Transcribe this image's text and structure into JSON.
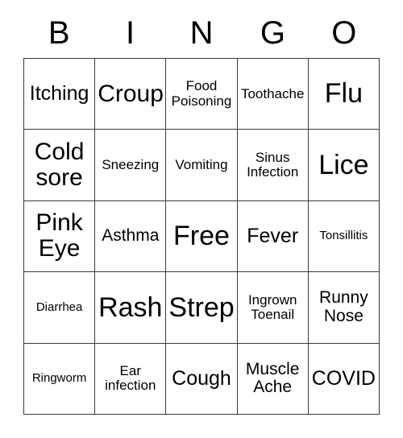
{
  "card": {
    "header_letters": [
      "B",
      "I",
      "N",
      "G",
      "O"
    ],
    "free_space_label": "Free",
    "border_color": "#3a3a3a",
    "background_color": "#ffffff",
    "text_color": "#000000",
    "columns": 5,
    "rows": 5,
    "cells": [
      {
        "text": "Itching",
        "size": "l"
      },
      {
        "text": "Croup",
        "size": "xl"
      },
      {
        "text": "Food\nPoisoning",
        "size": "s"
      },
      {
        "text": "Toothache",
        "size": "s"
      },
      {
        "text": "Flu",
        "size": "xxl"
      },
      {
        "text": "Cold\nsore",
        "size": "xl"
      },
      {
        "text": "Sneezing",
        "size": "s"
      },
      {
        "text": "Vomiting",
        "size": "s"
      },
      {
        "text": "Sinus\nInfection",
        "size": "s"
      },
      {
        "text": "Lice",
        "size": "xxl"
      },
      {
        "text": "Pink\nEye",
        "size": "xl"
      },
      {
        "text": "Asthma",
        "size": "m"
      },
      {
        "text": "Free",
        "size": "xxl"
      },
      {
        "text": "Fever",
        "size": "l"
      },
      {
        "text": "Tonsillitis",
        "size": "xs"
      },
      {
        "text": "Diarrhea",
        "size": "xs"
      },
      {
        "text": "Rash",
        "size": "xxl"
      },
      {
        "text": "Strep",
        "size": "xxl"
      },
      {
        "text": "Ingrown\nToenail",
        "size": "s"
      },
      {
        "text": "Runny\nNose",
        "size": "m"
      },
      {
        "text": "Ringworm",
        "size": "xs"
      },
      {
        "text": "Ear\ninfection",
        "size": "s"
      },
      {
        "text": "Cough",
        "size": "l"
      },
      {
        "text": "Muscle\nAche",
        "size": "m"
      },
      {
        "text": "COVID",
        "size": "l"
      }
    ]
  }
}
